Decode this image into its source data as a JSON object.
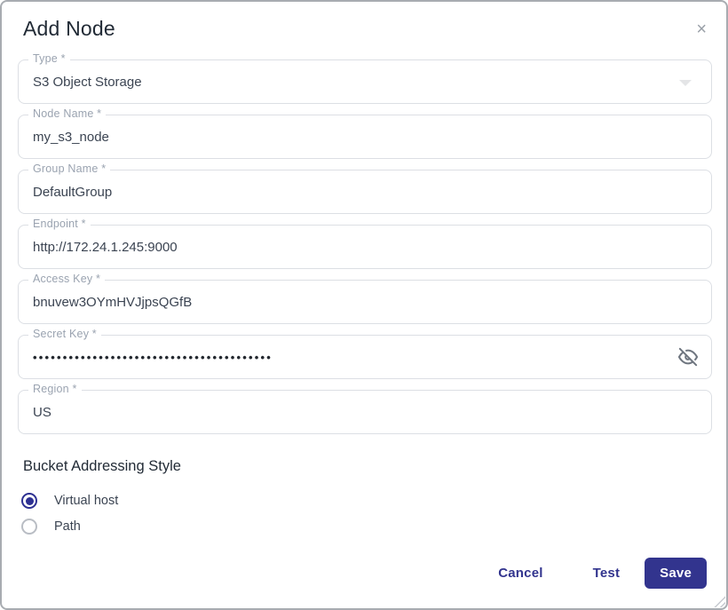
{
  "dialog": {
    "title": "Add Node",
    "close_icon": "×"
  },
  "fields": [
    {
      "label": "Type *",
      "value": "S3 Object Storage",
      "kind": "select"
    },
    {
      "label": "Node Name *",
      "value": "my_s3_node",
      "kind": "text"
    },
    {
      "label": "Group Name *",
      "value": "DefaultGroup",
      "kind": "text"
    },
    {
      "label": "Endpoint *",
      "value": "http://172.24.1.245:9000",
      "kind": "text"
    },
    {
      "label": "Access Key *",
      "value": "bnuvew3OYmHVJjpsQGfB",
      "kind": "text"
    },
    {
      "label": "Secret Key *",
      "value": "••••••••••••••••••••••••••••••••••••••••",
      "kind": "password"
    },
    {
      "label": "Region *",
      "value": "US",
      "kind": "text"
    }
  ],
  "bucket_addressing": {
    "heading": "Bucket Addressing Style",
    "options": [
      {
        "label": "Virtual host",
        "selected": true
      },
      {
        "label": "Path",
        "selected": false
      }
    ]
  },
  "actions": {
    "cancel": "Cancel",
    "test": "Test",
    "save": "Save"
  },
  "colors": {
    "accent": "#32348e",
    "radio_selected": "#2d3092",
    "label_gray": "#9aa3b0",
    "text_dark": "#3b4452"
  }
}
